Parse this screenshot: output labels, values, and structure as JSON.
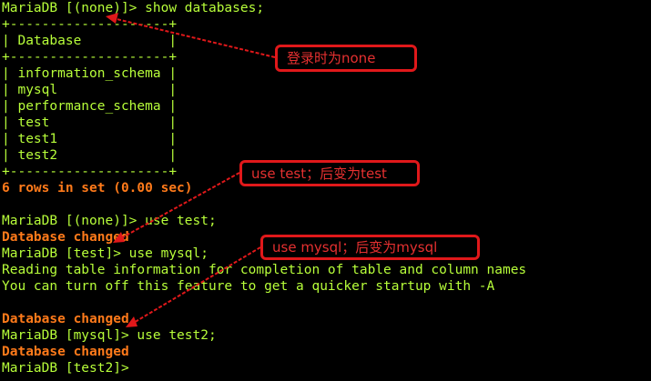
{
  "terminal": {
    "lines": [
      {
        "text": "MariaDB [(none)]> show databases;",
        "style": "green"
      },
      {
        "text": "+--------------------+",
        "style": "green"
      },
      {
        "text": "| Database           |",
        "style": "green"
      },
      {
        "text": "+--------------------+",
        "style": "green"
      },
      {
        "text": "| information_schema |",
        "style": "green"
      },
      {
        "text": "| mysql              |",
        "style": "green"
      },
      {
        "text": "| performance_schema |",
        "style": "green"
      },
      {
        "text": "| test               |",
        "style": "green"
      },
      {
        "text": "| test1              |",
        "style": "green"
      },
      {
        "text": "| test2              |",
        "style": "green"
      },
      {
        "text": "+--------------------+",
        "style": "green"
      },
      {
        "text": "6 rows in set (0.00 sec)",
        "style": "bold-orange"
      },
      {
        "text": "",
        "style": "green"
      },
      {
        "text": "MariaDB [(none)]> use test;",
        "style": "green"
      },
      {
        "text": "Database changed",
        "style": "bold-orange"
      },
      {
        "text": "MariaDB [test]> use mysql;",
        "style": "green"
      },
      {
        "text": "Reading table information for completion of table and column names",
        "style": "green"
      },
      {
        "text": "You can turn off this feature to get a quicker startup with -A",
        "style": "green"
      },
      {
        "text": "",
        "style": "green"
      },
      {
        "text": "Database changed",
        "style": "bold-orange"
      },
      {
        "text": "MariaDB [mysql]> use test2;",
        "style": "green"
      },
      {
        "text": "Database changed",
        "style": "bold-orange"
      },
      {
        "text": "MariaDB [test2]>",
        "style": "green"
      }
    ]
  },
  "annotations": {
    "note1": "登录时为none",
    "note2": "use test；后变为test",
    "note3": "use mysql；后变为mysql"
  },
  "colors": {
    "background": "#000000",
    "terminal_text": "#b8ff3a",
    "highlight_text": "#ff7a1a",
    "annotation_red": "#e0181a"
  }
}
